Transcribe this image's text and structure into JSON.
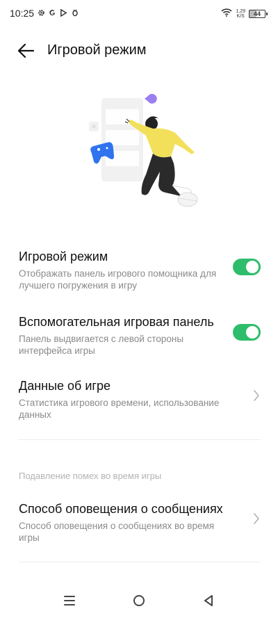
{
  "status_bar": {
    "time": "10:25",
    "net_speed_value": "1,29",
    "net_speed_unit": "K/S",
    "battery_level": "44",
    "icons": [
      "gear-icon",
      "google-icon",
      "play-store-icon",
      "usb-debug-icon",
      "wifi-icon"
    ]
  },
  "header": {
    "title": "Игровой режим",
    "back_icon": "arrow-left-icon"
  },
  "settings": [
    {
      "title": "Игровой режим",
      "description": "Отображать панель игрового помощника для лучшего погружения в игру",
      "control": "toggle",
      "enabled": true
    },
    {
      "title": "Вспомогательная игровая панель",
      "description": "Панель выдвигается с левой стороны интерфейса игры",
      "control": "toggle",
      "enabled": true
    },
    {
      "title": "Данные об игре",
      "description": "Статистика игрового времени, использование данных",
      "control": "chevron"
    }
  ],
  "section": {
    "label": "Подавление помех во время игры",
    "items": [
      {
        "title": "Способ оповещения о сообщениях",
        "description": "Способ оповещения о сообщениях во время игры",
        "control": "chevron"
      }
    ]
  },
  "colors": {
    "toggle_on": "#2ebd6b",
    "illustration_shirt": "#f2e05a",
    "illustration_gamepad": "#2f74ee",
    "illustration_pacman": "#9b7ff0"
  },
  "navbar": {
    "icons": [
      "menu-icon",
      "home-circle-icon",
      "back-triangle-icon"
    ]
  }
}
